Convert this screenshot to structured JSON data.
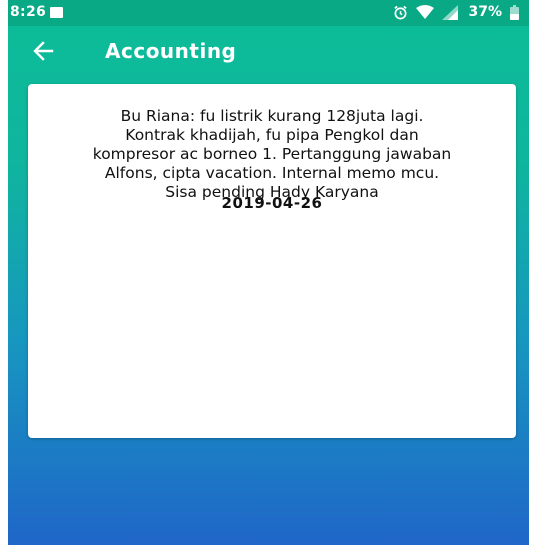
{
  "status_bar": {
    "time": "8:26",
    "battery_percent": "37%",
    "icons": [
      "image-icon",
      "alarm-icon",
      "wifi-icon",
      "signal-icon",
      "battery-icon"
    ]
  },
  "app_bar": {
    "title": "Accounting",
    "back_icon": "arrow-left-icon"
  },
  "note": {
    "lines": [
      "Bu Riana: fu listrik kurang 128juta lagi.",
      "Kontrak khadijah, fu pipa Pengkol dan",
      "kompresor ac borneo 1. Pertanggung jawaban",
      "Alfons, cipta vacation. Internal memo mcu.",
      "Sisa pending Hady Karyana"
    ],
    "date": "2019-04-26"
  },
  "colors": {
    "status_bar": "#0aa986",
    "gradient_top": "#0cbd97",
    "gradient_bottom": "#1f66c8",
    "card": "#ffffff"
  }
}
